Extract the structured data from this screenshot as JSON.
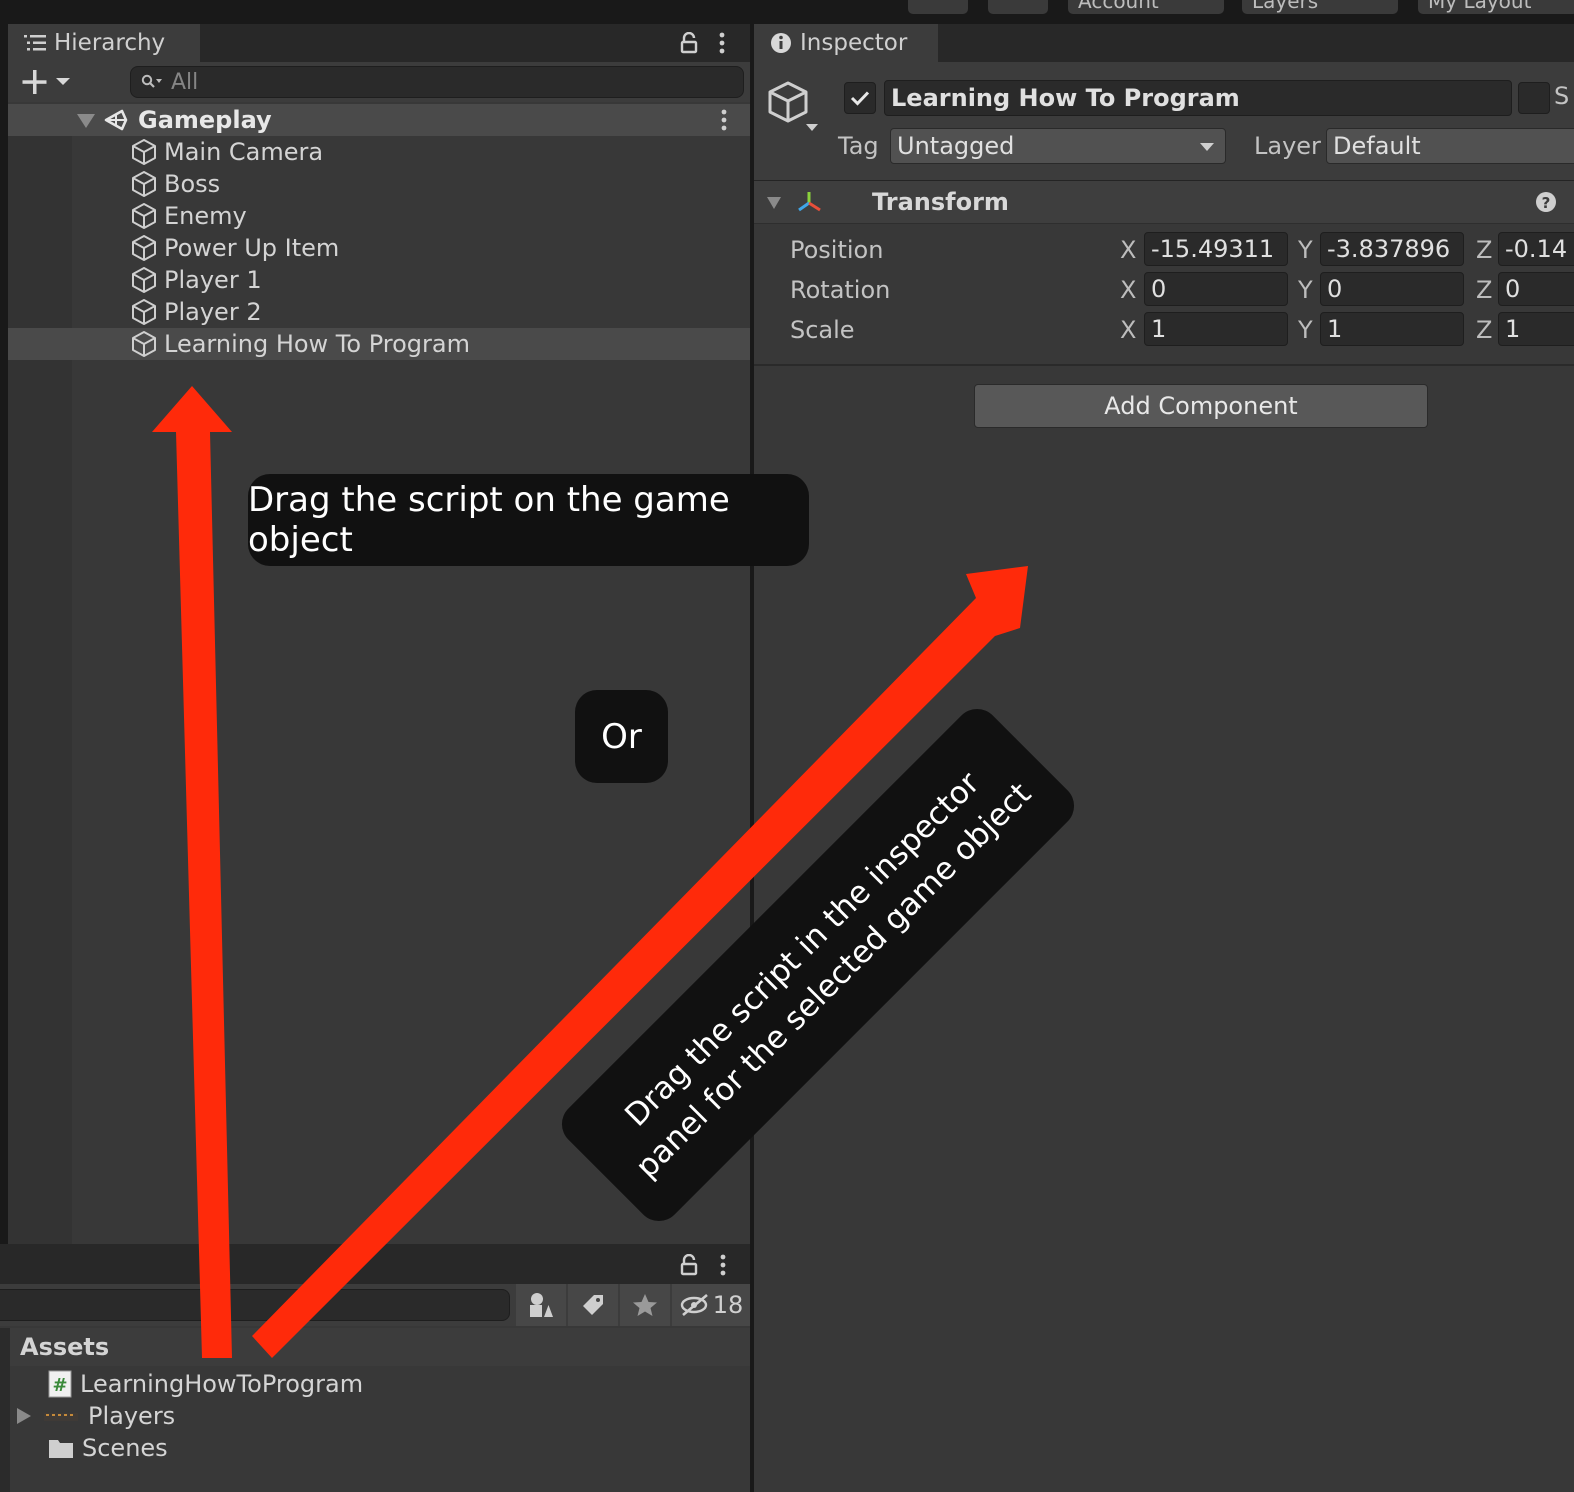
{
  "toolbar": {
    "buttons": [
      "Account",
      "Layers",
      "My Layout"
    ]
  },
  "hierarchy": {
    "tab_label": "Hierarchy",
    "search_placeholder": "All",
    "scene": "Gameplay",
    "items": [
      "Main Camera",
      "Boss",
      "Enemy",
      "Power Up Item",
      "Player 1",
      "Player 2",
      "Learning How To Program"
    ],
    "selected_index": 6
  },
  "inspector": {
    "tab_label": "Inspector",
    "object_name": "Learning How To Program",
    "static_label": "S",
    "tag_label": "Tag",
    "tag_value": "Untagged",
    "layer_label": "Layer",
    "layer_value": "Default",
    "transform_title": "Transform",
    "rows": [
      {
        "label": "Position",
        "x": "-15.49311",
        "y": "-3.837896",
        "z": "-0.14"
      },
      {
        "label": "Rotation",
        "x": "0",
        "y": "0",
        "z": "0"
      },
      {
        "label": "Scale",
        "x": "1",
        "y": "1",
        "z": "1"
      }
    ],
    "axis_x": "X",
    "axis_y": "Y",
    "axis_z": "Z",
    "add_component": "Add Component"
  },
  "project": {
    "hidden_count": "18",
    "assets_header": "Assets",
    "items": [
      {
        "name": "LearningHowToProgram",
        "type": "script"
      },
      {
        "name": "Players",
        "type": "folder-collapsed"
      },
      {
        "name": "Scenes",
        "type": "folder"
      }
    ]
  },
  "annotations": {
    "callout_top": "Drag the script on the game object",
    "callout_or": "Or",
    "callout_diag": "Drag the script in the inspector panel for the selected game object",
    "arrow_color": "#ff2a0a"
  }
}
